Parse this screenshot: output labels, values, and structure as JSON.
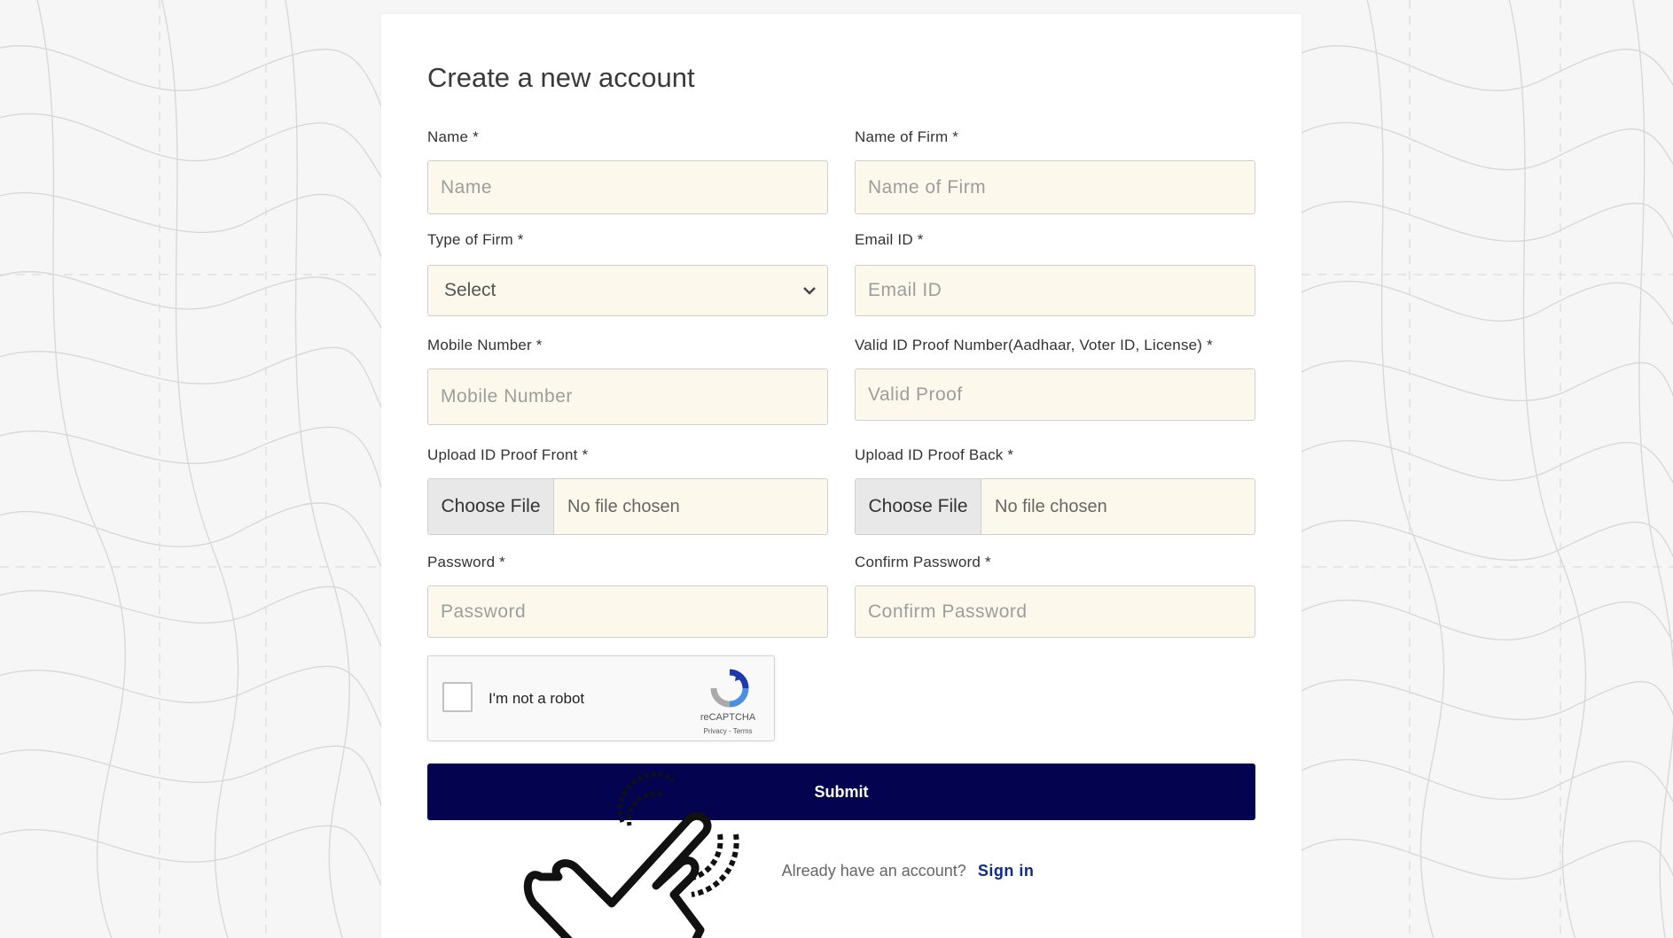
{
  "form": {
    "title": "Create a new account",
    "fields": {
      "name": {
        "label": "Name *",
        "placeholder": "Name"
      },
      "firm_name": {
        "label": "Name of Firm *",
        "placeholder": "Name of Firm"
      },
      "firm_type": {
        "label": "Type of Firm *",
        "selected": "Select"
      },
      "email": {
        "label": "Email ID *",
        "placeholder": "Email ID"
      },
      "mobile": {
        "label": "Mobile Number *",
        "placeholder": "Mobile Number"
      },
      "id_proof_number": {
        "label": "Valid ID Proof Number(Aadhaar, Voter ID, License) *",
        "placeholder": "Valid Proof"
      },
      "id_front": {
        "label": "Upload ID Proof Front *",
        "button": "Choose File",
        "status": "No file chosen"
      },
      "id_back": {
        "label": "Upload ID Proof Back *",
        "button": "Choose File",
        "status": "No file chosen"
      },
      "password": {
        "label": "Password *",
        "placeholder": "Password"
      },
      "confirm_password": {
        "label": "Confirm Password *",
        "placeholder": "Confirm Password"
      }
    },
    "captcha": {
      "label": "I'm not a robot",
      "brand": "reCAPTCHA",
      "links": "Privacy - Terms"
    },
    "submit_label": "Submit",
    "signin": {
      "prompt": "Already have an account?",
      "link": "Sign in"
    }
  },
  "colors": {
    "submit_bg": "#03034f",
    "input_bg": "#fcf9ec",
    "link": "#0c2a8c"
  },
  "icons": [
    "chevron-down-icon",
    "recaptcha-logo-icon",
    "pointing-hand-cursor-icon"
  ]
}
